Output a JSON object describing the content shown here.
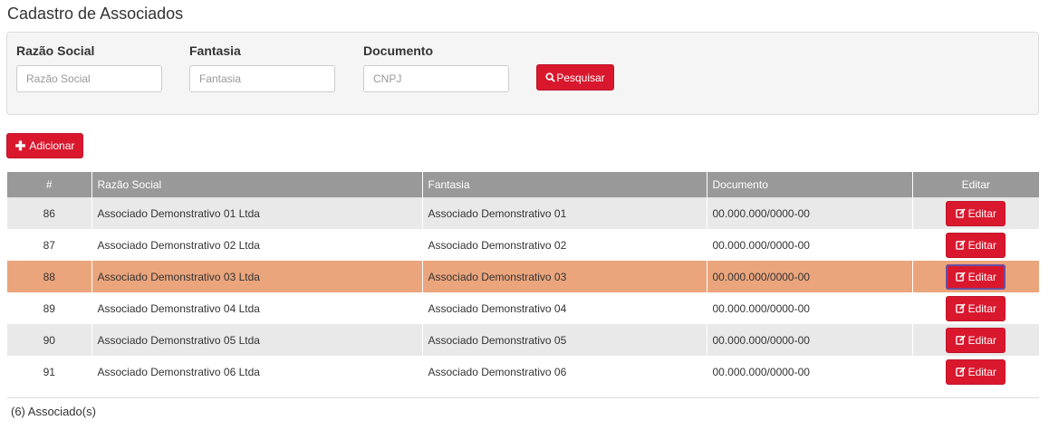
{
  "page": {
    "title": "Cadastro de Associados"
  },
  "filters": [
    {
      "label": "Razão Social",
      "placeholder": "Razão Social",
      "value": ""
    },
    {
      "label": "Fantasia",
      "placeholder": "Fantasia",
      "value": ""
    },
    {
      "label": "Documento",
      "placeholder": "CNPJ",
      "value": ""
    }
  ],
  "search_button": {
    "label": "Pesquisar",
    "icon": "search-icon"
  },
  "add_button": {
    "label": "Adicionar",
    "icon": "plus-icon"
  },
  "table": {
    "columns": [
      "#",
      "Razão Social",
      "Fantasia",
      "Documento",
      "Editar"
    ],
    "rows": [
      {
        "id": "86",
        "razao": "Associado Demonstrativo 01 Ltda",
        "fantasia": "Associado Demonstrativo 01",
        "documento": "00.000.000/0000-00",
        "edit": "Editar"
      },
      {
        "id": "87",
        "razao": "Associado Demonstrativo 02 Ltda",
        "fantasia": "Associado Demonstrativo 02",
        "documento": "00.000.000/0000-00",
        "edit": "Editar"
      },
      {
        "id": "88",
        "razao": "Associado Demonstrativo 03 Ltda",
        "fantasia": "Associado Demonstrativo 03",
        "documento": "00.000.000/0000-00",
        "edit": "Editar"
      },
      {
        "id": "89",
        "razao": "Associado Demonstrativo 04 Ltda",
        "fantasia": "Associado Demonstrativo 04",
        "documento": "00.000.000/0000-00",
        "edit": "Editar"
      },
      {
        "id": "90",
        "razao": "Associado Demonstrativo 05 Ltda",
        "fantasia": "Associado Demonstrativo 05",
        "documento": "00.000.000/0000-00",
        "edit": "Editar"
      },
      {
        "id": "91",
        "razao": "Associado Demonstrativo 06 Ltda",
        "fantasia": "Associado Demonstrativo 06",
        "documento": "00.000.000/0000-00",
        "edit": "Editar"
      }
    ],
    "selected_row_id": "88"
  },
  "footer": {
    "count_text": "(6) Associado(s)"
  },
  "colors": {
    "accent": "#d9182e",
    "header_bg": "#999999",
    "row_alt": "#e9e9e9",
    "row_selected": "#eba57c"
  }
}
